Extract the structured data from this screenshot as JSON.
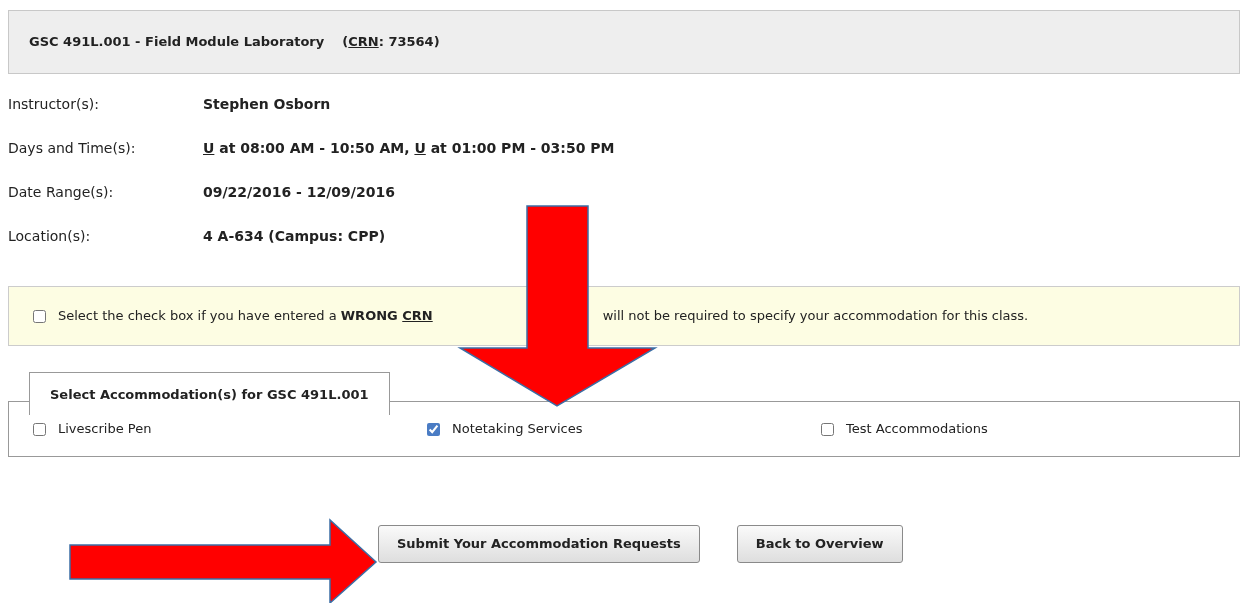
{
  "course_header": {
    "segments": [
      {
        "text": "GSC 491L.001 - Field Module Laboratory    ("
      },
      {
        "text": "CRN",
        "underline": true
      },
      {
        "text": ": 73564)"
      }
    ]
  },
  "details": [
    {
      "label": "Instructor(s):",
      "segments": [
        {
          "text": "Stephen Osborn"
        }
      ]
    },
    {
      "label": "Days and Time(s):",
      "segments": [
        {
          "text": "U",
          "underline": true
        },
        {
          "text": " at 08:00 AM - 10:50 AM, "
        },
        {
          "text": "U",
          "underline": true
        },
        {
          "text": " at 01:00 PM - 03:50 PM"
        }
      ]
    },
    {
      "label": "Date Range(s):",
      "segments": [
        {
          "text": "09/22/2016 - 12/09/2016"
        }
      ]
    },
    {
      "label": "Location(s):",
      "segments": [
        {
          "text": "4 A-634 (Campus: CPP)"
        }
      ]
    }
  ],
  "wrong_crn_notice": {
    "checked": false,
    "text_parts": [
      [
        {
          "text": "Select the check box if you have entered a "
        },
        {
          "text": "WRONG ",
          "bold": true
        },
        {
          "text": "CRN",
          "bold": true,
          "underline": true
        }
      ],
      [
        {
          "text": "will not be required to specify your accommodation for this class."
        }
      ]
    ]
  },
  "accommodations": {
    "legend": "Select Accommodation(s) for GSC 491L.001",
    "options": [
      {
        "label": "Livescribe Pen",
        "checked": false
      },
      {
        "label": "Notetaking Services",
        "checked": true
      },
      {
        "label": "Test Accommodations",
        "checked": false
      }
    ]
  },
  "buttons": [
    {
      "label": "Submit Your Accommodation Requests"
    },
    {
      "label": "Back to Overview"
    }
  ],
  "annotations": [
    {
      "kind": "down_arrow"
    },
    {
      "kind": "right_arrow"
    }
  ]
}
